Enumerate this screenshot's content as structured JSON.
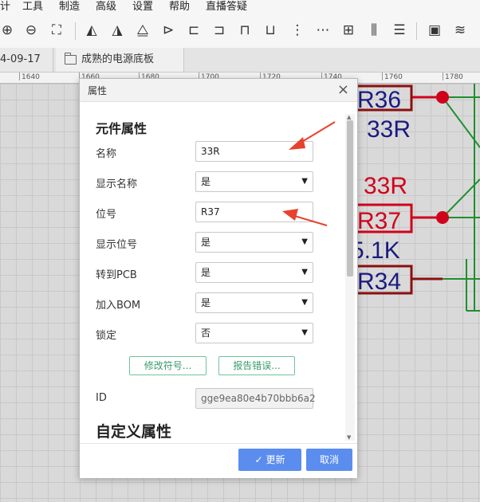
{
  "menu": [
    "计",
    "工具",
    "制造",
    "高级",
    "设置",
    "帮助",
    "直播答疑"
  ],
  "tabs": {
    "first": "4-09-17",
    "active": "成熟的电源底板"
  },
  "ruler": [
    "1640",
    "1660",
    "1680",
    "1700",
    "1720",
    "1740",
    "1760",
    "1780"
  ],
  "schematic": {
    "labels": {
      "r36": "R36",
      "r36_value": "33R",
      "r37_value": "33R",
      "r37": "R37",
      "r34_value": "5.1K",
      "r34": "R34"
    },
    "colors": {
      "wire": "#1f8f2e",
      "red": "#d0021b",
      "blue": "#1a1a80",
      "box": "#8b0f0f"
    }
  },
  "dialog": {
    "title": "属性",
    "sections": {
      "component": "元件属性",
      "custom": "自定义属性"
    },
    "fields": {
      "name": {
        "label": "名称",
        "value": "33R"
      },
      "show_name": {
        "label": "显示名称",
        "value": "是"
      },
      "designator": {
        "label": "位号",
        "value": "R37"
      },
      "show_designator": {
        "label": "显示位号",
        "value": "是"
      },
      "to_pcb": {
        "label": "转到PCB",
        "value": "是"
      },
      "add_bom": {
        "label": "加入BOM",
        "value": "是"
      },
      "lock": {
        "label": "锁定",
        "value": "否"
      },
      "id": {
        "label": "ID",
        "value": "gge9ea80e4b70bbb6a2"
      }
    },
    "buttons": {
      "modify_symbol": "修改符号...",
      "report_error": "报告错误...",
      "update": "更新",
      "cancel": "取消"
    }
  },
  "colors": {
    "primary": "#5b8def",
    "outline_green": "#3a9a6e",
    "arrow": "#e8412c"
  }
}
